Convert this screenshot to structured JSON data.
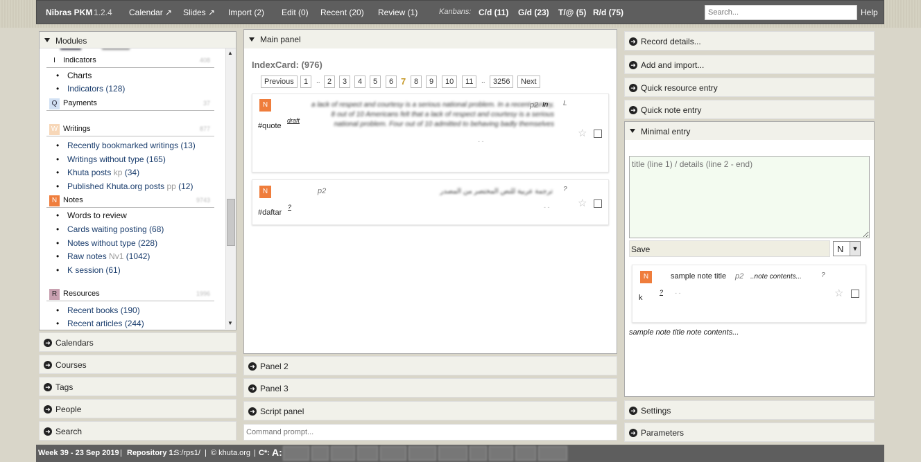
{
  "topbar": {
    "brand": "Nibras PKM",
    "version": "1.2.4",
    "calendar": "Calendar ↗",
    "slides": "Slides ↗",
    "import": "Import (2)",
    "edit": "Edit (0)",
    "recent": "Recent (20)",
    "review": "Review (1)",
    "kanbans": "Kanbans:",
    "kb1": "C/d (11)",
    "kb2": "G/d (23)",
    "kb3": "T/@ (5)",
    "kb4": "R/d (75)",
    "search_placeholder": "Search...",
    "help": "Help"
  },
  "modules": {
    "title": "Modules",
    "sections": {
      "indicators": {
        "icon": "I",
        "name": "Indicators",
        "count": "408"
      },
      "payments": {
        "icon": "Q",
        "name": "Payments",
        "count": "37"
      },
      "writings": {
        "icon": "W",
        "name": "Writings",
        "count": "877"
      },
      "notes": {
        "icon": "N",
        "name": "Notes",
        "count": "9743"
      },
      "resources": {
        "icon": "R",
        "name": "Resources",
        "count": "1996"
      }
    },
    "items": {
      "charts": "Charts",
      "indicators": "Indicators (128)",
      "bookmarked": "Recently bookmarked writings (13)",
      "wo_type": "Writings without type (165)",
      "khuta": "Khuta posts",
      "khuta_code": "kp",
      "khuta_count": "(34)",
      "published": "Published Khuta.org posts",
      "published_code": "pp",
      "published_count": "(12)",
      "words": "Words to review",
      "cards": "Cards waiting posting (68)",
      "notes_wo": "Notes without type (228)",
      "raw": "Raw notes",
      "raw_code": "Nv1",
      "raw_count": "(1042)",
      "ksession": "K session (61)",
      "books": "Recent books (190)",
      "articles": "Recent articles (244)"
    }
  },
  "left_panels": {
    "calendars": "Calendars",
    "courses": "Courses",
    "tags": "Tags",
    "people": "People",
    "search": "Search"
  },
  "main": {
    "title": "Main panel",
    "index_title": "IndexCard: (976)",
    "pager": {
      "prev": "Previous",
      "p1": "1",
      "e1": "..",
      "p2": "2",
      "p3": "3",
      "p4": "4",
      "p5": "5",
      "p6": "6",
      "p7": "7",
      "p8": "8",
      "p9": "9",
      "p10": "10",
      "p11": "11",
      "e2": "..",
      "last": "3256",
      "next": "Next"
    },
    "card1": {
      "badge": "N",
      "tag": "#quote",
      "status": "draft",
      "pg": "p2",
      "intro": "In",
      "flag": "L",
      "body": "a lack of respect and courtesy is a serious national problem. In a recent survey, 8 out of 10 Americans felt that a lack of respect and courtesy is a serious national problem. Four out of 10 admitted to behaving badly themselves",
      "dash": "- -"
    },
    "card2": {
      "badge": "N",
      "tag": "#daftar",
      "q": "?",
      "pg": "p2",
      "flag": "?",
      "body": "ترجمة عربية للنص المختصر من المصدر",
      "dash": "- -"
    }
  },
  "bottom_panels": {
    "panel2": "Panel 2",
    "panel3": "Panel 3",
    "script": "Script panel",
    "command_placeholder": "Command prompt..."
  },
  "right": {
    "record": "Record details...",
    "addimport": "Add and import...",
    "quickres": "Quick resource entry",
    "quicknote": "Quick note entry",
    "minimal": "Minimal entry",
    "textarea_placeholder": "title (line 1) / details (line 2 - end)",
    "save": "Save",
    "select_value": "N",
    "sample": {
      "badge": "N",
      "title": "sample note title",
      "pg": "p2",
      "contents": "..note contents...",
      "flag": "?",
      "tag": "k",
      "q": "?",
      "dash": "- -"
    },
    "preview": "sample note title note contents...",
    "settings": "Settings",
    "parameters": "Parameters"
  },
  "footer": {
    "week": "Week 39 - 23 Sep 2019",
    "sep1": "|",
    "repo_label": "Repository 1:",
    "repo_path": "S:/rps1/",
    "sep2": "|",
    "copyright": "© khuta.org",
    "sep3": "|",
    "cstar": "C*:",
    "a": "A:"
  }
}
